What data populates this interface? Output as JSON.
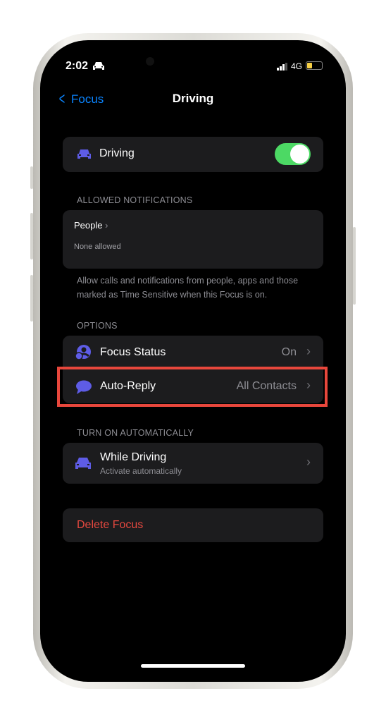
{
  "status": {
    "time": "2:02",
    "network": "4G",
    "battery_level": 0.35
  },
  "nav": {
    "back": "Focus",
    "title": "Driving"
  },
  "focus_toggle": {
    "label": "Driving",
    "on": true
  },
  "allowed": {
    "header": "ALLOWED NOTIFICATIONS",
    "people_label": "People",
    "people_value": "None allowed",
    "footer": "Allow calls and notifications from people, apps and those marked as Time Sensitive when this Focus is on."
  },
  "options": {
    "header": "OPTIONS",
    "focus_status": {
      "label": "Focus Status",
      "value": "On"
    },
    "auto_reply": {
      "label": "Auto-Reply",
      "value": "All Contacts"
    }
  },
  "auto": {
    "header": "TURN ON AUTOMATICALLY",
    "while_driving": {
      "label": "While Driving",
      "sub": "Activate automatically"
    }
  },
  "delete_label": "Delete Focus",
  "colors": {
    "accent": "#0a84ff",
    "icon": "#5e5ce6",
    "toggle": "#4cd964",
    "destructive": "#e5483f",
    "highlight": "#e8473c"
  }
}
